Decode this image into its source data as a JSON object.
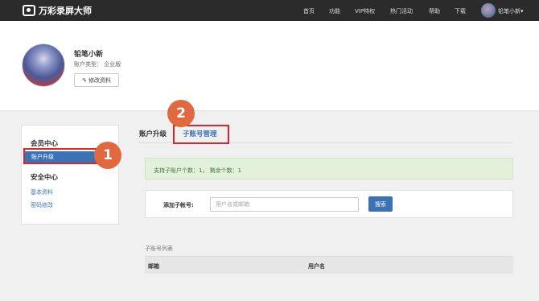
{
  "topbar": {
    "app_title": "万彩录屏大师",
    "nav": [
      "首页",
      "功能",
      "VIP特权",
      "热门活动",
      "帮助",
      "下载"
    ],
    "user_name": "铅笔小新▾"
  },
  "profile": {
    "name": "铅笔小新",
    "account_type": "账户类型： 企业版",
    "edit_label": "修改资料"
  },
  "sidebar": {
    "member_center": "会员中心",
    "account_upgrade": "账户升级",
    "security_center": "安全中心",
    "basic_info": "基本资料",
    "change_password": "密码修改"
  },
  "tabs": {
    "upgrade": "账户升级",
    "sub_accounts": "子账号管理"
  },
  "info": {
    "message": "支持子账户个数：1， 剩余个数：1"
  },
  "form": {
    "label": "添加子帐号:",
    "placeholder": "用户名或邮箱",
    "search_label": "搜索"
  },
  "list": {
    "title": "子账号列表",
    "columns": [
      "邮箱",
      "用户名"
    ]
  },
  "callouts": {
    "one": "1",
    "two": "2"
  },
  "colors": {
    "accent_blue": "#3a72b5",
    "callout_orange": "#e0693f",
    "highlight_red": "#d9262c"
  }
}
